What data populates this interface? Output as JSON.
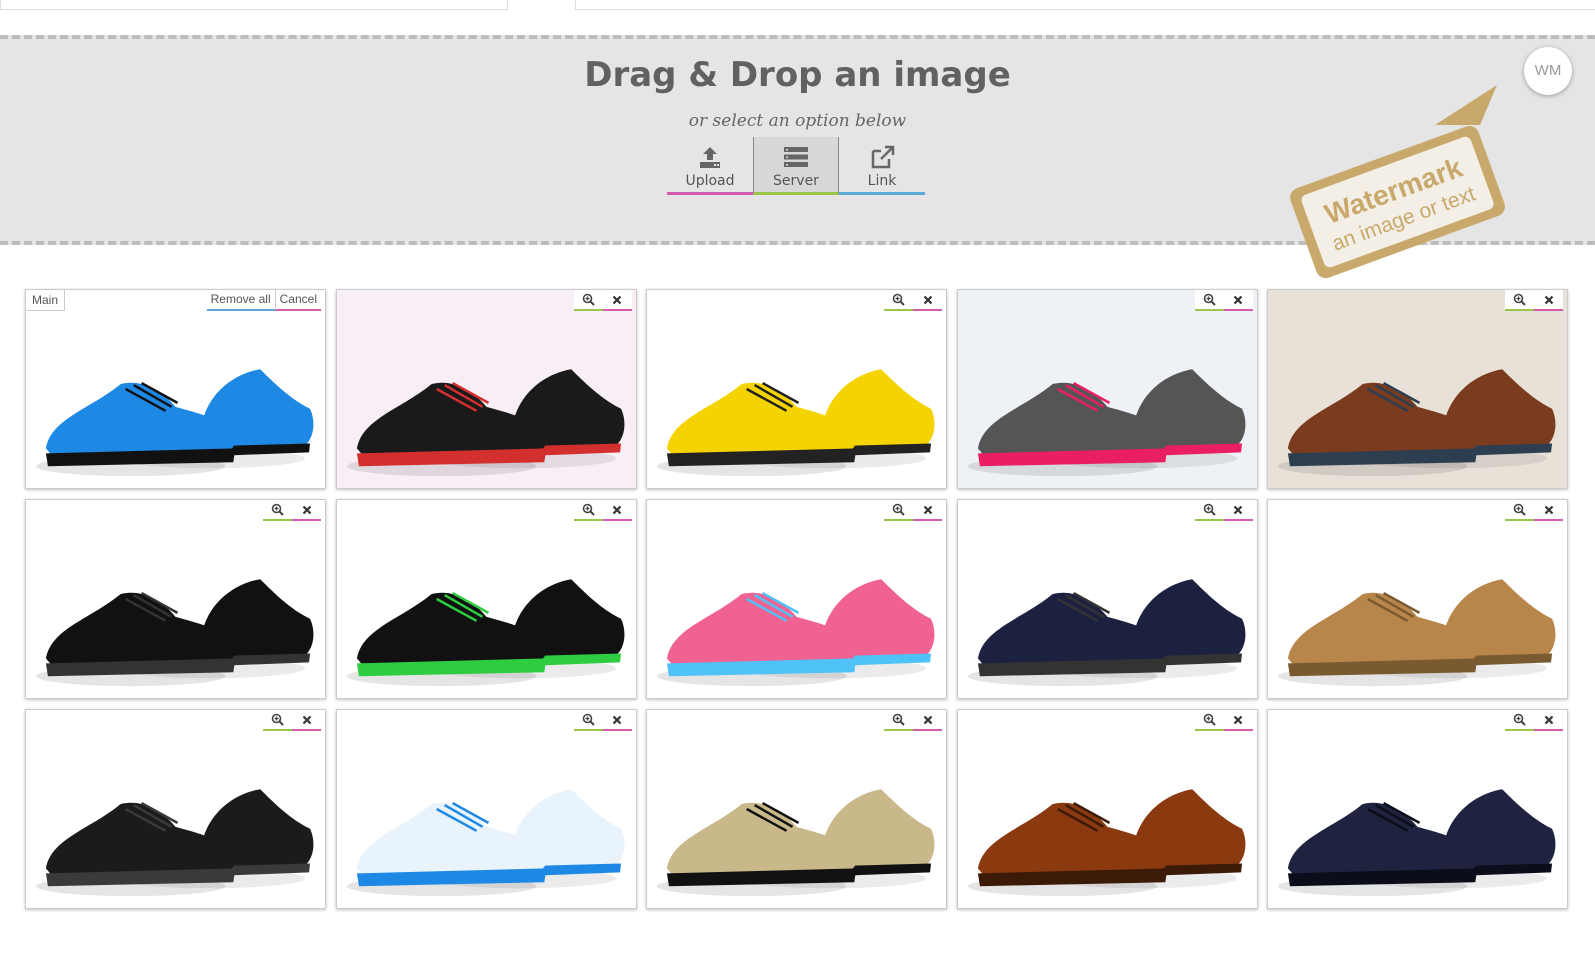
{
  "dropzone": {
    "title": "Drag & Drop an image",
    "subtitle": "or select an option below",
    "options": [
      {
        "label": "Upload",
        "icon": "upload-icon",
        "accent": "#d35bb0"
      },
      {
        "label": "Server",
        "icon": "server-icon",
        "accent": "#9ac54a"
      },
      {
        "label": "Link",
        "icon": "external-link-icon",
        "accent": "#5aa9d6"
      }
    ]
  },
  "watermark": {
    "badge": "WM",
    "tag_line1": "Watermark",
    "tag_line2": "an image or text"
  },
  "gallery": {
    "main_label": "Main",
    "remove_all_label": "Remove all",
    "cancel_label": "Cancel",
    "images": [
      {
        "name": "blue-sneaker"
      },
      {
        "name": "black-red-high-top"
      },
      {
        "name": "colorful-runner"
      },
      {
        "name": "grey-pink-high-top"
      },
      {
        "name": "boat-shoes"
      },
      {
        "name": "black-suede-shoes"
      },
      {
        "name": "black-air-max"
      },
      {
        "name": "pink-running-shoe"
      },
      {
        "name": "navy-work-boots"
      },
      {
        "name": "tan-wedge-bootie"
      },
      {
        "name": "black-boat-shoes"
      },
      {
        "name": "white-blue-running-shoe"
      },
      {
        "name": "gold-ballet-flat"
      },
      {
        "name": "brown-oxford"
      },
      {
        "name": "navy-cap-toe-oxford"
      }
    ]
  }
}
